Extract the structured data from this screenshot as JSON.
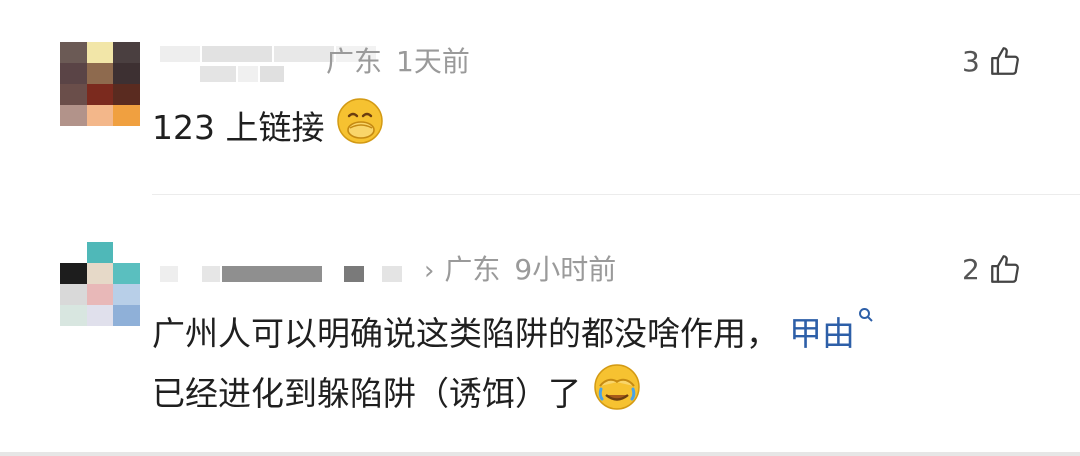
{
  "comments": [
    {
      "location": "广东",
      "time": "1天前",
      "likes": "3",
      "text": "123 上链接",
      "emoji": "hand-over-mouth-emoji"
    },
    {
      "location": "广东",
      "time": "9小时前",
      "likes": "2",
      "text_line1": "广州人可以明确说这类陷阱的都没啥作用，",
      "link": "甲由",
      "text_line2": "已经进化到躲陷阱（诱饵）了",
      "emoji": "face-palm-laughing-emoji"
    }
  ],
  "colors": {
    "link": "#2d5fa8",
    "meta": "#9a9a9a"
  }
}
